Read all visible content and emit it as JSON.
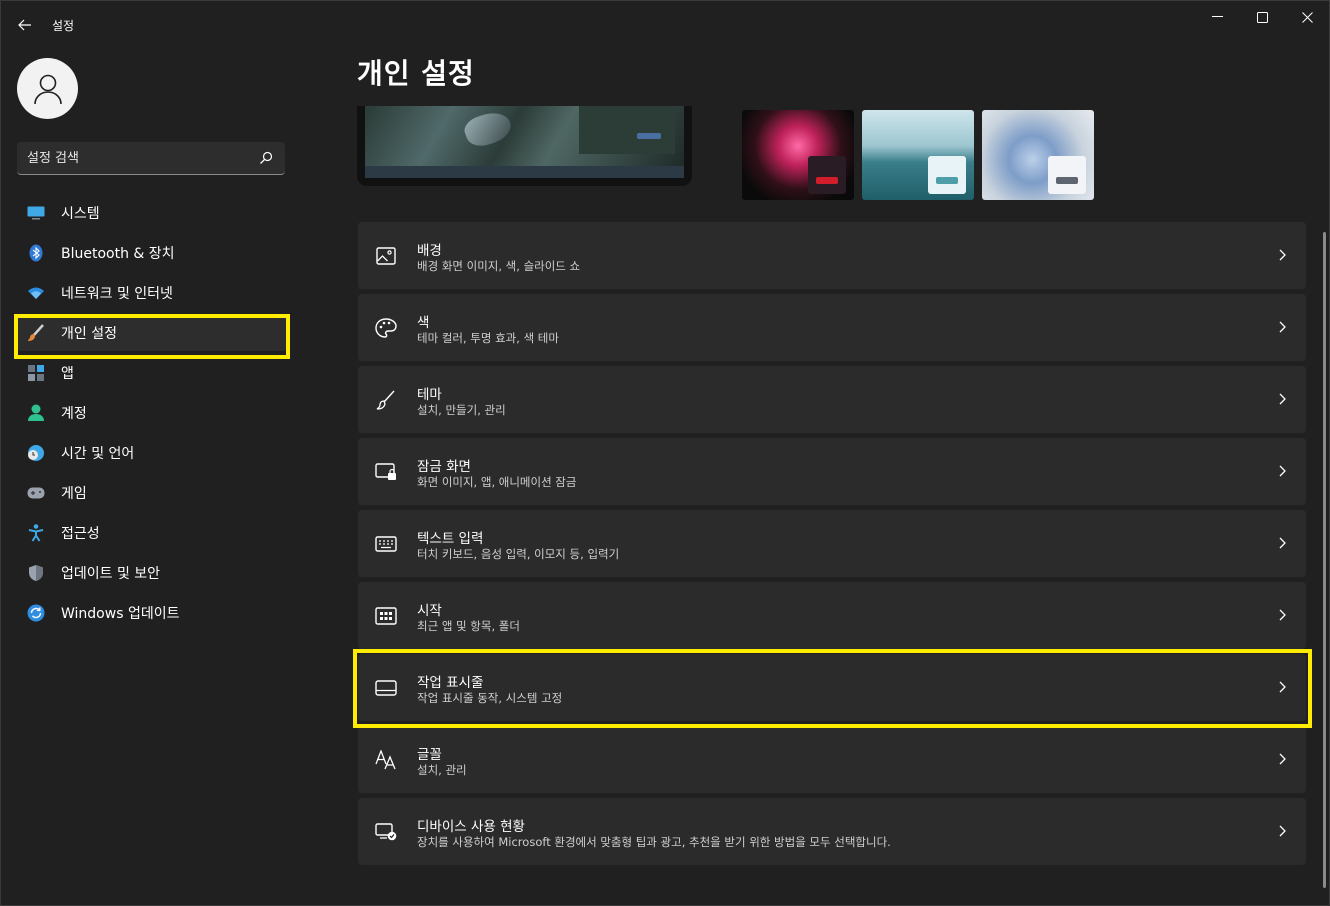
{
  "window": {
    "title": "설정"
  },
  "sidebar": {
    "search_placeholder": "설정 검색",
    "items": [
      {
        "label": "시스템",
        "icon": "monitor-icon"
      },
      {
        "label": "Bluetooth & 장치",
        "icon": "bluetooth-icon"
      },
      {
        "label": "네트워크 및 인터넷",
        "icon": "wifi-icon"
      },
      {
        "label": "개인 설정",
        "icon": "brush-icon",
        "selected": true
      },
      {
        "label": "앱",
        "icon": "apps-icon"
      },
      {
        "label": "계정",
        "icon": "person-icon"
      },
      {
        "label": "시간 및 언어",
        "icon": "clock-globe-icon"
      },
      {
        "label": "게임",
        "icon": "gamepad-icon"
      },
      {
        "label": "접근성",
        "icon": "accessibility-icon"
      },
      {
        "label": "업데이트 및 보안",
        "icon": "shield-icon"
      },
      {
        "label": "Windows 업데이트",
        "icon": "update-icon"
      }
    ]
  },
  "main": {
    "title": "개인 설정",
    "settings": [
      {
        "title": "배경",
        "desc": "배경 화면 이미지, 색, 슬라이드 쇼",
        "icon": "image-icon"
      },
      {
        "title": "색",
        "desc": "테마 컬러, 투명 효과, 색 테마",
        "icon": "palette-icon"
      },
      {
        "title": "테마",
        "desc": "설치, 만들기, 관리",
        "icon": "brush-icon"
      },
      {
        "title": "잠금 화면",
        "desc": "화면 이미지, 앱, 애니메이션 잠금",
        "icon": "lock-screen-icon"
      },
      {
        "title": "텍스트 입력",
        "desc": "터치 키보드, 음성 입력, 이모지 등, 입력기",
        "icon": "keyboard-icon"
      },
      {
        "title": "시작",
        "desc": "최근 앱 및 항목, 폴더",
        "icon": "start-icon"
      },
      {
        "title": "작업 표시줄",
        "desc": "작업 표시줄 동작, 시스템 고정",
        "icon": "taskbar-icon"
      },
      {
        "title": "글꼴",
        "desc": "설치, 관리",
        "icon": "font-icon"
      },
      {
        "title": "디바이스 사용 현황",
        "desc": "장치를 사용하여 Microsoft 환경에서 맞춤형 팁과 광고, 추천을 받기 위한 방법을 모두 선택합니다.",
        "icon": "device-usage-icon"
      }
    ]
  },
  "colors": {
    "background": "#202020",
    "card": "#2b2b2b",
    "highlight": "#ffec00",
    "accent": "#4cc2ff"
  }
}
